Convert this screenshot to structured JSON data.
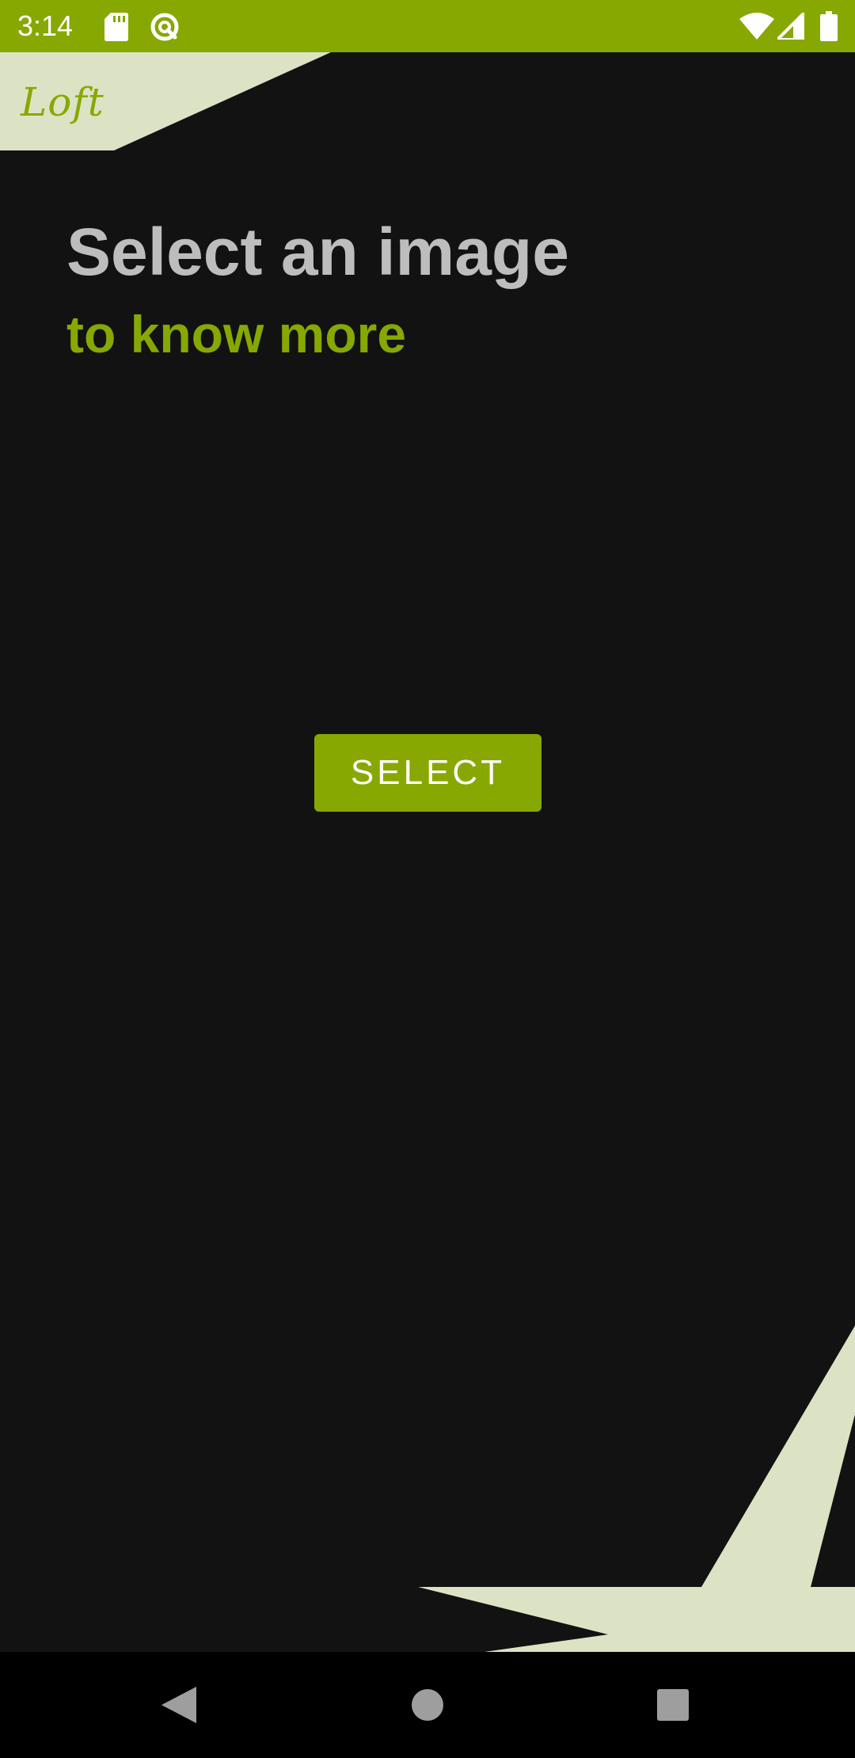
{
  "status_bar": {
    "time": "3:14",
    "left_icons": [
      "sd-card-icon",
      "sync-icon"
    ],
    "right_icons": [
      "wifi-icon",
      "cell-signal-icon",
      "battery-icon"
    ]
  },
  "app": {
    "logo_text": "Loft",
    "heading": "Select an image",
    "subheading": "to know more",
    "select_button_label": "SELECT"
  },
  "nav_bar": {
    "items": [
      "back-icon",
      "home-icon",
      "recents-icon"
    ]
  },
  "colors": {
    "accent": "#87a800",
    "background": "#121212",
    "decoration": "#dce3c4",
    "heading": "#bdbdbd",
    "nav_background": "#000000"
  }
}
